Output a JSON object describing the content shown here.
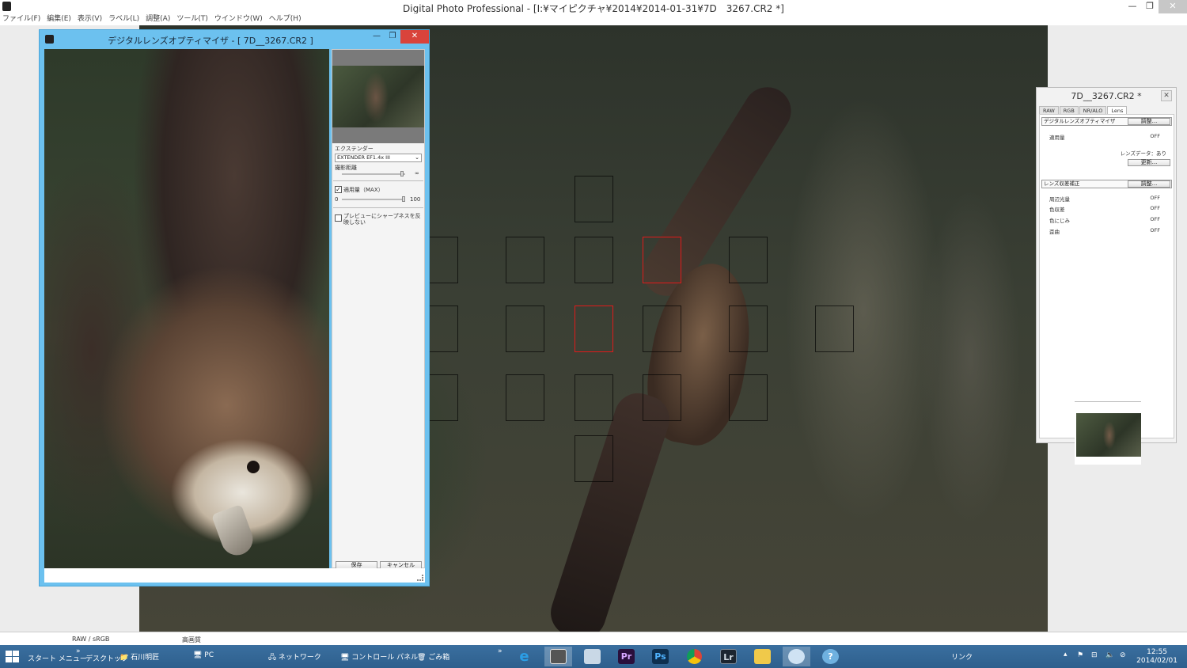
{
  "app": {
    "title": "Digital Photo Professional - [I:¥マイピクチャ¥2014¥2014-01-31¥7D__3267.CR2 *]",
    "controls": {
      "minimize": "—",
      "maximize": "❐",
      "close": "✕"
    }
  },
  "menu": [
    "ファイル(F)",
    "編集(E)",
    "表示(V)",
    "ラベル(L)",
    "調整(A)",
    "ツール(T)",
    "ウインドウ(W)",
    "ヘルプ(H)"
  ],
  "status": {
    "colorspace": "RAW / sRGB",
    "quality": "高画質"
  },
  "dlo": {
    "title": "デジタルレンズオプティマイザ - [ 7D__3267.CR2 ]",
    "controls": {
      "minimize": "—",
      "maximize": "❐",
      "close": "✕"
    },
    "extender_label": "エクステンダー",
    "extender_value": "EXTENDER EF1.4x III",
    "distance_label": "撮影距離",
    "distance_max": "∞",
    "amount_label": "適用量（MAX）",
    "amount_checked": true,
    "amount_min": "0",
    "amount_max": "100",
    "sharpness_label": "プレビューにシャープネスを反映しない",
    "sharpness_checked": false,
    "save_button": "保存",
    "cancel_button": "キャンセル"
  },
  "palette": {
    "title": "7D__3267.CR2 *",
    "close": "✕",
    "tabs": [
      "RAW",
      "RGB",
      "NR/ALO",
      "Lens"
    ],
    "selected_tab": "Lens",
    "dlo_section": {
      "label": "デジタルレンズオプティマイザ",
      "button": "調整..."
    },
    "amount_row": {
      "label": "適用量",
      "value": "OFF"
    },
    "lens_data": "レンズデータ：あり",
    "update_button": "更新...",
    "aberration_section": {
      "label": "レンズ収差補正",
      "button": "調整..."
    },
    "rows": [
      {
        "label": "周辺光量",
        "value": "OFF"
      },
      {
        "label": "色収差",
        "value": "OFF"
      },
      {
        "label": "色にじみ",
        "value": "OFF"
      },
      {
        "label": "歪曲",
        "value": "OFF"
      }
    ]
  },
  "taskbar": {
    "start_menu": "スタート メニュー",
    "desktop": "デスクトップ",
    "user": "石川明匠",
    "pc": "PC",
    "network": "ネットワーク",
    "control_panel": "コントロール パネル",
    "recycle_bin": "ごみ箱",
    "links": "リンク",
    "time": "12:55",
    "date": "2014/02/01",
    "chevron1": "»",
    "chevron2": "»",
    "ps_label": "Ps",
    "pr_label": "Pr",
    "lr_label": "Lr",
    "ie_label": "e"
  },
  "colors": {
    "accent": "#6cc1ef",
    "af_active": "#e01a1a",
    "taskbar": "#3a6f9f"
  }
}
